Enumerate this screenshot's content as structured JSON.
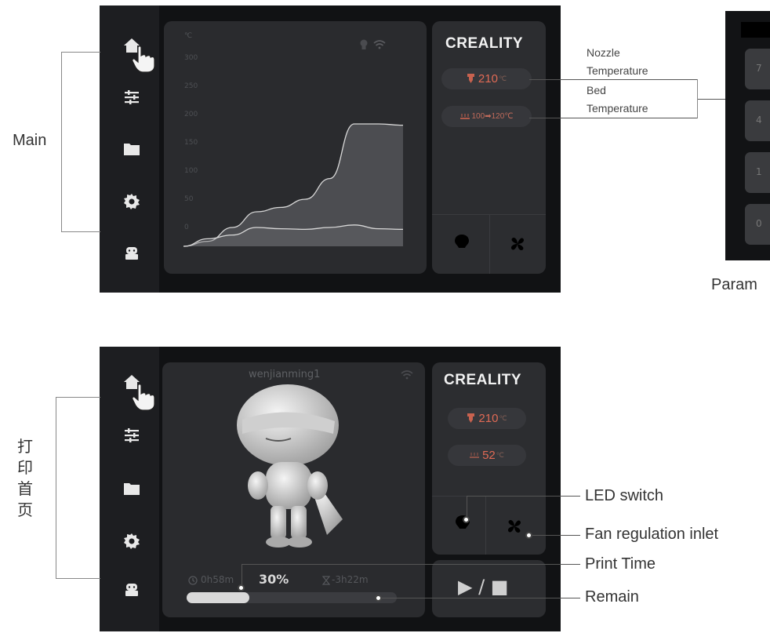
{
  "main_screen": {
    "brand": "CREALITY",
    "chart_axis_unit": "℃",
    "y_ticks": [
      "300",
      "250",
      "200",
      "150",
      "100",
      "50",
      "0"
    ],
    "nozzle_temp": "210",
    "nozzle_unit": "℃",
    "bed_temp": "100",
    "bed_target": "120℃",
    "bed_arrow": "➡",
    "chart_data": {
      "type": "area",
      "ylim": [
        0,
        300
      ],
      "series": [
        {
          "values": [
            0,
            8,
            30,
            55,
            62,
            75,
            108,
            195,
            195,
            193
          ]
        },
        {
          "values": [
            0,
            12,
            18,
            30,
            28,
            27,
            30,
            34,
            28,
            27
          ]
        }
      ]
    }
  },
  "print_screen": {
    "brand": "CREALITY",
    "filename": "wenjianming1",
    "nozzle_temp": "210",
    "nozzle_unit": "℃",
    "bed_temp": "52",
    "bed_unit": "℃",
    "elapsed": "0h58m",
    "percent": "30%",
    "remaining": "-3h22m",
    "progress": 0.3,
    "play_stop": "▶ / ■"
  },
  "partial_screen": {
    "caption": "Param",
    "keys": [
      "7",
      "4",
      "1",
      "0"
    ]
  },
  "annotations": {
    "main_label": "Main",
    "print_label_chars": [
      "打",
      "印",
      "首",
      "页"
    ],
    "nozzle_line1": "Nozzle",
    "nozzle_line2": "Temperature",
    "bed_line1": "Bed",
    "bed_line2": "Temperature",
    "led_switch": "LED switch",
    "fan_inlet": "Fan regulation inlet",
    "print_time": "Print Time",
    "remain": "Remain"
  },
  "colors": {
    "screen_bg": "#111214",
    "nav_bg": "#1d1e21",
    "temp_red": "#e06a55",
    "chart_line": "#d8d8d8"
  }
}
